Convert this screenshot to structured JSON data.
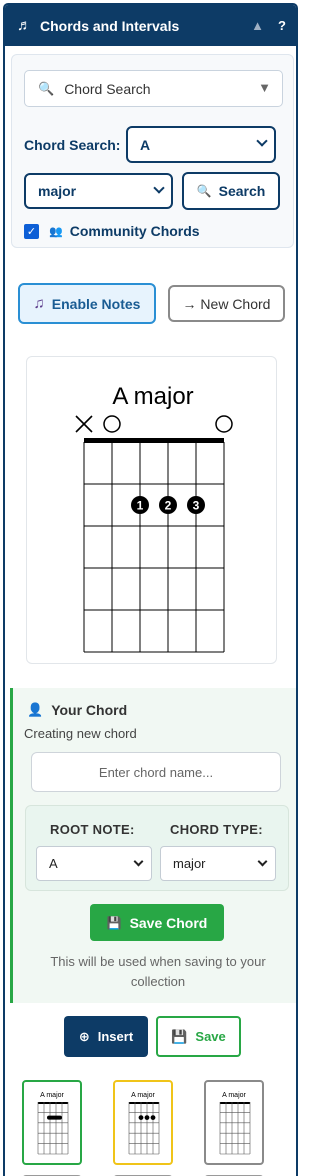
{
  "header": {
    "title": "Chords and Intervals",
    "help": "?",
    "music_icon": "music-note-icon",
    "collapse_icon": "triangle-up-icon"
  },
  "search": {
    "mode_label": "Chord Search",
    "label": "Chord Search:",
    "root_value": "A",
    "type_value": "major",
    "button_label": "Search",
    "community_label": "Community Chords",
    "community_checked": true
  },
  "actions": {
    "enable_notes": "Enable Notes",
    "new_chord": "→ New Chord"
  },
  "diagram": {
    "title": "A major",
    "string_markers": [
      "×",
      "○",
      "",
      "",
      "",
      "○"
    ],
    "fingers": [
      {
        "string": 3,
        "fret": 2,
        "label": "1"
      },
      {
        "string": 4,
        "fret": 2,
        "label": "2"
      },
      {
        "string": 5,
        "fret": 2,
        "label": "3"
      }
    ]
  },
  "your_chord": {
    "title": "Your Chord",
    "status": "Creating new chord",
    "name_placeholder": "Enter chord name...",
    "root_label": "ROOT NOTE:",
    "type_label": "CHORD TYPE:",
    "root_value": "A",
    "type_value": "major",
    "save_label": "Save Chord",
    "hint": "This will be used when saving to your collection"
  },
  "buttons": {
    "insert": "Insert",
    "save": "Save"
  },
  "thumbnails": [
    {
      "title": "A major",
      "style": "barre",
      "accent": "#28a745"
    },
    {
      "title": "A major",
      "style": "dots",
      "accent": "#f0c419"
    },
    {
      "title": "A major",
      "style": "open",
      "accent": "#8a8a8a"
    }
  ],
  "colors": {
    "primary": "#0d3b66",
    "success": "#28a745",
    "accent_blue": "#2a8fd4"
  }
}
